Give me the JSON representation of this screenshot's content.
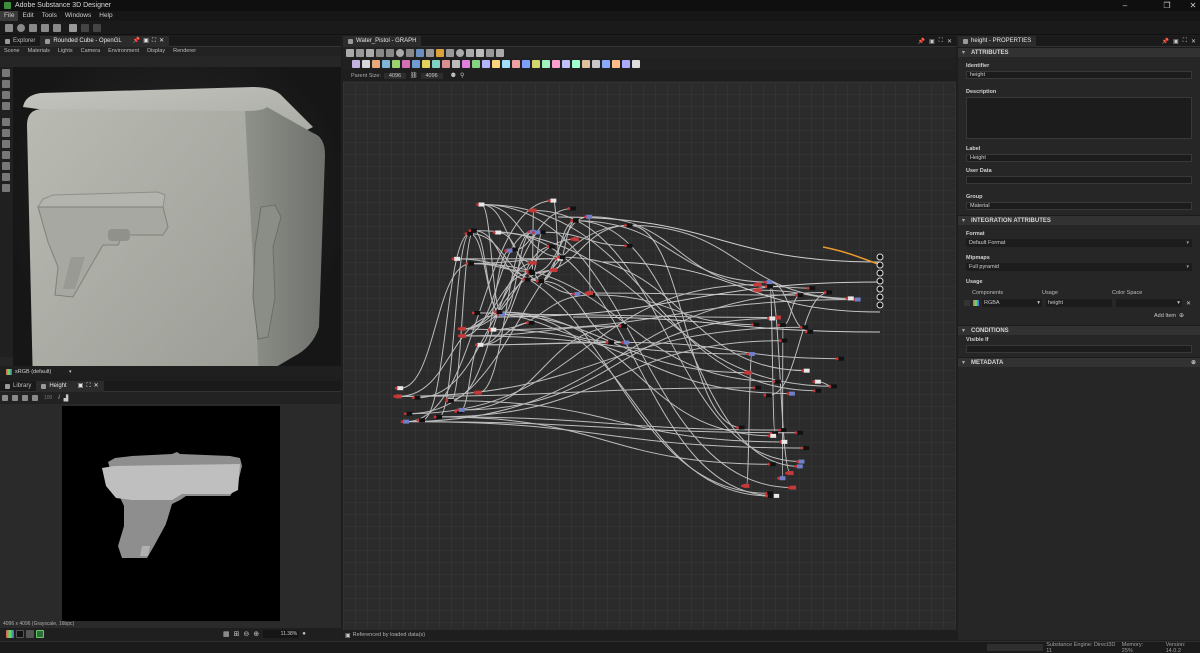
{
  "window": {
    "title": "Adobe Substance 3D Designer"
  },
  "menu": [
    "File",
    "Edit",
    "Tools",
    "Windows",
    "Help"
  ],
  "left_panel": {
    "tabs": [
      {
        "label": "Explorer",
        "active": false
      },
      {
        "label": "Rounded Cube - OpenGL",
        "active": true
      }
    ],
    "viewport_menu": [
      "Scene",
      "Materials",
      "Lights",
      "Camera",
      "Environment",
      "Display",
      "Renderer"
    ],
    "colorspace": "sRGB (default)"
  },
  "preview_panel": {
    "tabs": [
      {
        "label": "Library",
        "active": false
      },
      {
        "label": "Height",
        "active": true
      }
    ],
    "zoom_select": "100",
    "info": "4096 x 4096 (Grayscale, 16bpc)",
    "zoom_level": "11.38%"
  },
  "graph_panel": {
    "title": "Water_Pistol - GRAPH",
    "parent_size_label": "Parent Size:",
    "parent_size_value": "4096",
    "output_size_value": "4096",
    "status": "Referenced by loaded data(s)",
    "palette_colors": [
      "#c2b3e0",
      "#d7d7d7",
      "#e9a97b",
      "#7fb6d9",
      "#9bd36f",
      "#d36fb5",
      "#6f9cd3",
      "#e3d25b",
      "#7fd3c6",
      "#d98f8f",
      "#bcbcbc",
      "#e07fe0",
      "#83d383",
      "#b3b3ff",
      "#ffd27f",
      "#9fe0ff",
      "#f0a0a0",
      "#7f9fff",
      "#d3d36f",
      "#a0f0c0",
      "#ff9fcf",
      "#c0c0ff",
      "#9fffd0",
      "#e0c0a0",
      "#c8c8c8",
      "#88aaff",
      "#ffbb88",
      "#aaaaff",
      "#dddddd"
    ]
  },
  "properties": {
    "tab_title": "height - PROPERTIES",
    "attributes_header": "ATTRIBUTES",
    "identifier_label": "Identifier",
    "identifier_value": "height",
    "description_label": "Description",
    "label_label": "Label",
    "label_value": "Height",
    "user_data_label": "User Data",
    "group_label": "Group",
    "group_value": "Material",
    "integration_header": "INTEGRATION ATTRIBUTES",
    "format_label": "Format",
    "format_value": "Default Format",
    "mipmaps_label": "Mipmaps",
    "mipmaps_value": "Full pyramid",
    "usage_label": "Usage",
    "usage_columns": [
      "Components",
      "Usage",
      "Color Space"
    ],
    "usage_row": {
      "components": "RGBA",
      "usage": "height",
      "colorspace": ""
    },
    "add_item": "Add Item",
    "conditions_header": "CONDITIONS",
    "visible_if_label": "Visible If",
    "metadata_header": "METADATA"
  },
  "status_bar": {
    "engine": "Substance Engine: Direct3D 11",
    "memory": "Memory: 25%",
    "version": "Version: 14.0.2"
  }
}
